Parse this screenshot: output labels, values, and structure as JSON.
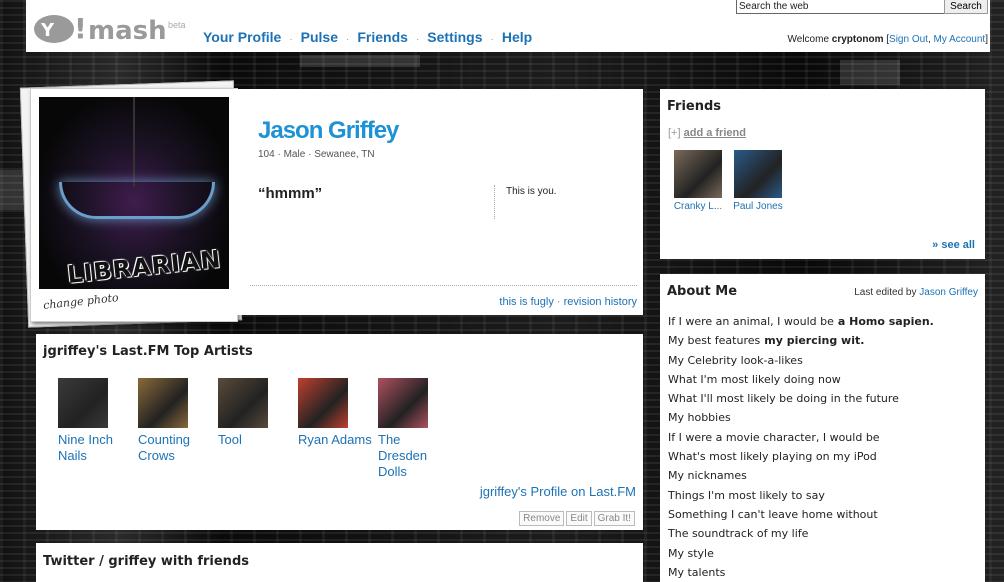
{
  "header": {
    "logo_text": "mash",
    "beta": "beta",
    "nav": [
      "Your Profile",
      "Pulse",
      "Friends",
      "Settings",
      "Help"
    ],
    "nav_separator": "·",
    "search_placeholder": "Search the web",
    "search_button": "Search",
    "welcome_prefix": "Welcome",
    "username": "cryptonom",
    "sign_out": "Sign Out",
    "my_account": "My Account"
  },
  "profile": {
    "change_photo": "change photo",
    "photo_caption": "LIBRARIAN",
    "name": "Jason Griffey",
    "age": "104",
    "gender": "Male",
    "location": "Sewanee, TN",
    "meta_separator": "·",
    "quote": "“hmmm”",
    "this_is_you": "This is you.",
    "link_fugly": "this is fugly",
    "link_revision": "revision history",
    "link_separator": "·"
  },
  "lastfm": {
    "title": "jgriffey's Last.FM Top Artists",
    "artists": [
      {
        "name": "Nine Inch Nails",
        "color": "#3a3a3a"
      },
      {
        "name": "Counting Crows",
        "color": "#8a6a3a"
      },
      {
        "name": "Tool",
        "color": "#5a4a3a"
      },
      {
        "name": "Ryan Adams",
        "color": "#c04030"
      },
      {
        "name": "The Dresden Dolls",
        "color": "#b05060"
      }
    ],
    "profile_link": "jgriffey's Profile on Last.FM",
    "buttons": [
      "Remove",
      "Edit",
      "Grab It!"
    ]
  },
  "twitter": {
    "title": "Twitter / griffey with friends"
  },
  "friends": {
    "title": "Friends",
    "add_prefix": "[+]",
    "add_link": "add a friend",
    "list": [
      {
        "name": "Cranky L...",
        "color": "#7a6a5a"
      },
      {
        "name": "Paul Jones",
        "color": "#2a5a8a"
      }
    ],
    "see_all": "» see all"
  },
  "about": {
    "title": "About Me",
    "last_edited_prefix": "Last edited by",
    "last_edited_by": "Jason Griffey",
    "items": [
      {
        "q": "If I were an animal, I would be",
        "a": "a Homo sapien."
      },
      {
        "q": "My best features",
        "a": "my piercing wit."
      },
      {
        "q": "My Celebrity look-a-likes",
        "a": ""
      },
      {
        "q": "What I'm most likely doing now",
        "a": ""
      },
      {
        "q": "What I'll most likely be doing in the future",
        "a": ""
      },
      {
        "q": "My hobbies",
        "a": ""
      },
      {
        "q": "If I were a movie character, I would be",
        "a": ""
      },
      {
        "q": "What's most likely playing on my iPod",
        "a": ""
      },
      {
        "q": "My nicknames",
        "a": ""
      },
      {
        "q": "Things I'm most likely to say",
        "a": ""
      },
      {
        "q": "Something I can't leave home without",
        "a": ""
      },
      {
        "q": "The soundtrack of my life",
        "a": ""
      },
      {
        "q": "My style",
        "a": ""
      },
      {
        "q": "My talents",
        "a": ""
      }
    ]
  }
}
